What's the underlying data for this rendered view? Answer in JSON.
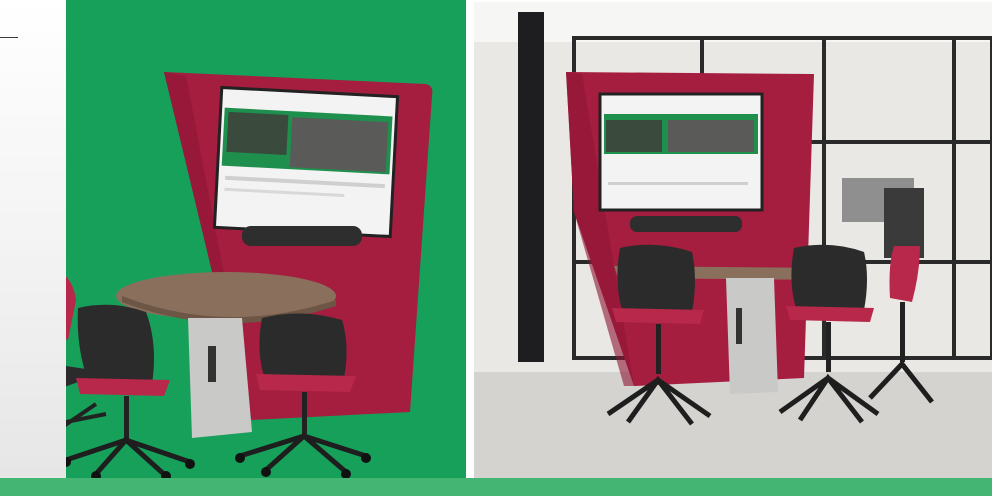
{
  "colors": {
    "green_backdrop": "#17a05a",
    "bottom_band": "#45b574",
    "booth_red": "#a51d3f",
    "table_wood": "#8a6f5c",
    "chair_black": "#2b2b2b",
    "seat_red": "#b8284a",
    "pedestal_grey": "#c9c9c7",
    "floor_grey": "#d4d3cf"
  },
  "icons": {
    "left_photo": "meeting-booth-render",
    "right_photo": "meeting-booth-office-photo"
  }
}
